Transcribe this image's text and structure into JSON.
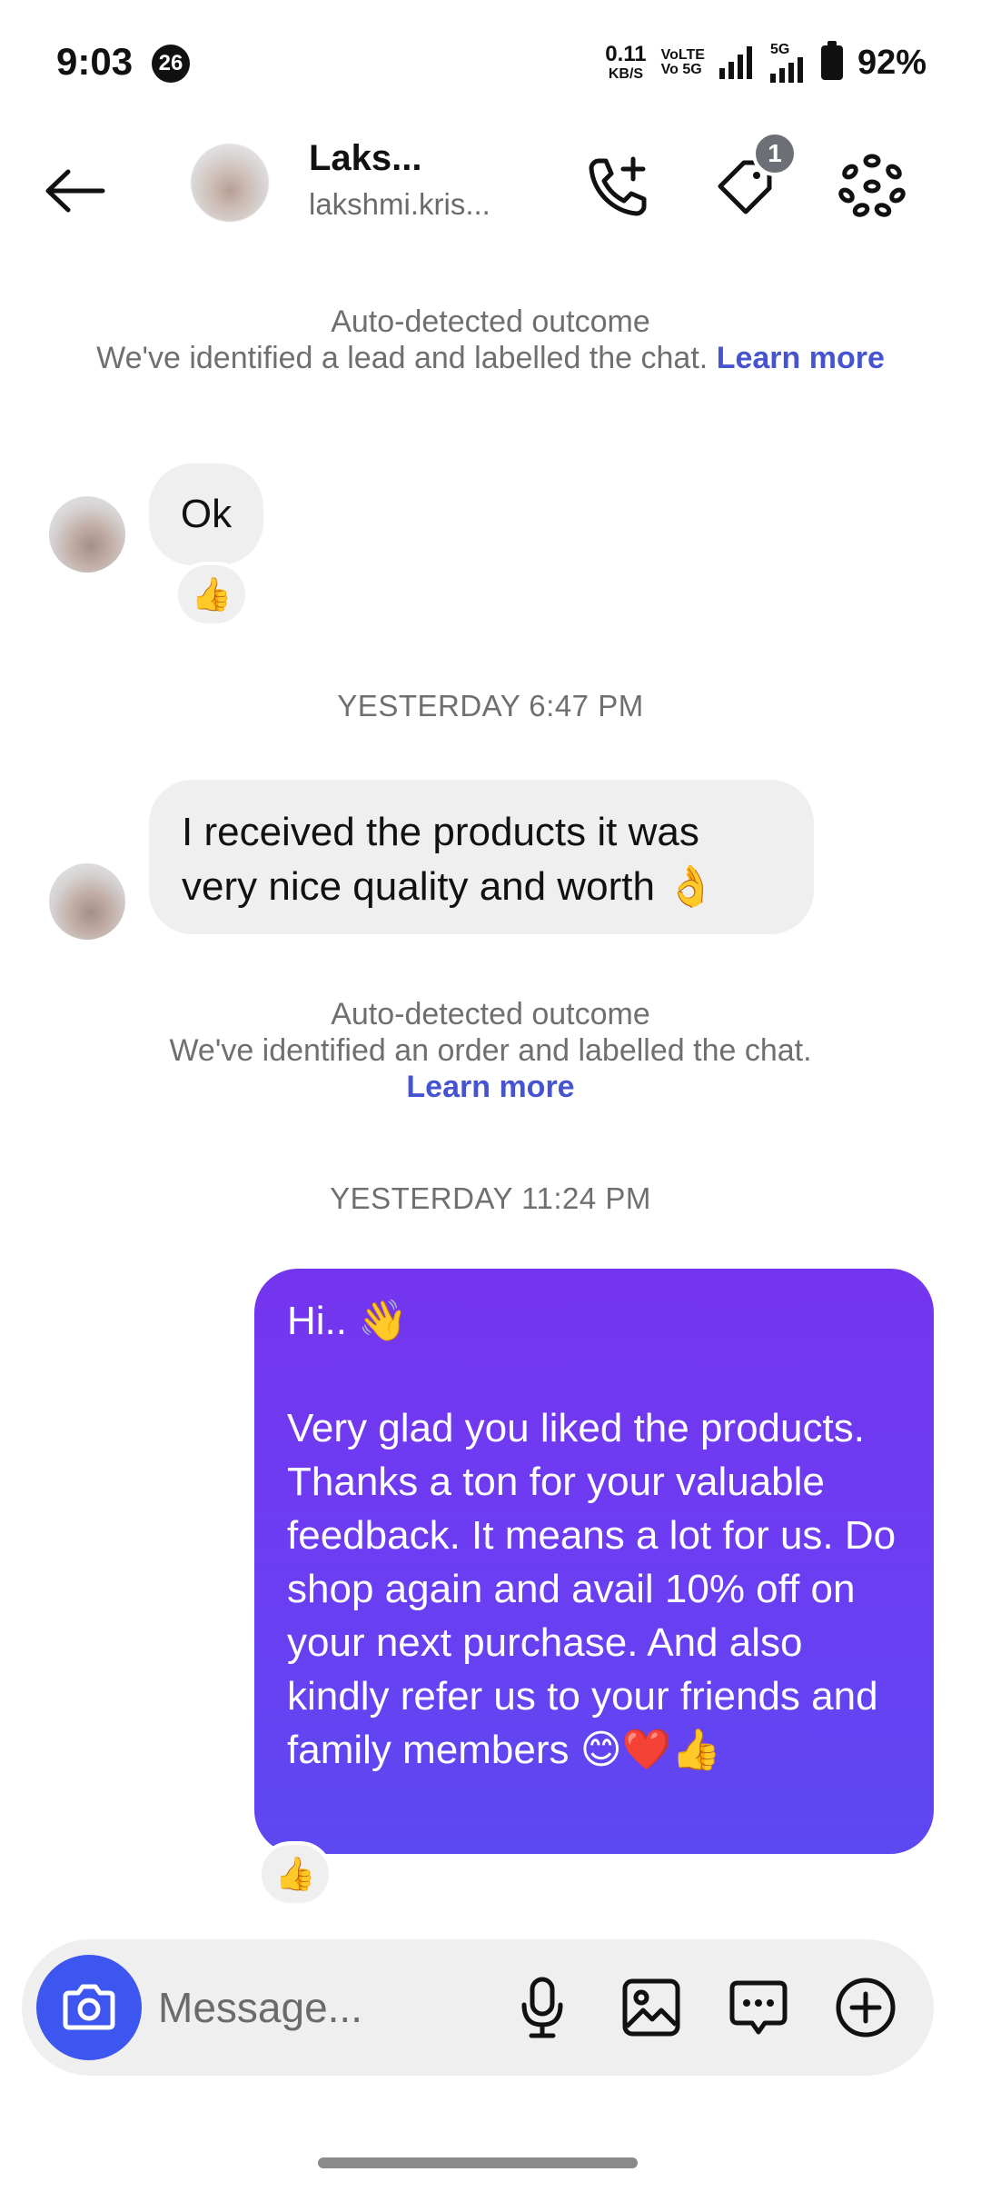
{
  "status_bar": {
    "time": "9:03",
    "notif_count": "26",
    "net_speed": "0.11",
    "net_unit": "KB/S",
    "volte1": "VoLTE",
    "volte2": "Vo 5G",
    "fiveg": "5G",
    "battery": "92%"
  },
  "header": {
    "name": "Laks...",
    "username": "lakshmi.kris...",
    "tag_count": "1",
    "icons": [
      "back-arrow-icon",
      "add-call-icon",
      "tag-icon",
      "more-dots-icon"
    ]
  },
  "notices": [
    {
      "title": "Auto-detected outcome",
      "text": "We've identified a lead and labelled the chat.",
      "link": "Learn more"
    },
    {
      "title": "Auto-detected outcome",
      "text": "We've identified an order and labelled the chat.",
      "link": "Learn more"
    }
  ],
  "messages": {
    "incoming_1": {
      "text": "Ok",
      "reaction": "👍"
    },
    "timestamp_1": "YESTERDAY 6:47 PM",
    "incoming_2": {
      "line1": "I received the products it was",
      "line2": "very nice quality and worth 👌"
    },
    "timestamp_2": "YESTERDAY 11:24 PM",
    "outgoing_1": {
      "greeting": "Hi.. 👋",
      "body": "Very glad you liked the products. Thanks a ton for your valuable feedback. It means a lot for us. Do shop again and avail 10% off on your next purchase. And also kindly refer us to your friends and family members 😊❤️👍",
      "reaction": "👍"
    }
  },
  "composer": {
    "placeholder": "Message...",
    "icons": [
      "camera-icon",
      "microphone-icon",
      "gallery-icon",
      "chat-bubble-icon",
      "plus-circle-icon"
    ]
  },
  "colors": {
    "accent": "#3e56f0",
    "bubble_out": "#6d3cf2",
    "link": "#4655cf",
    "bubble_in": "#efefef"
  }
}
